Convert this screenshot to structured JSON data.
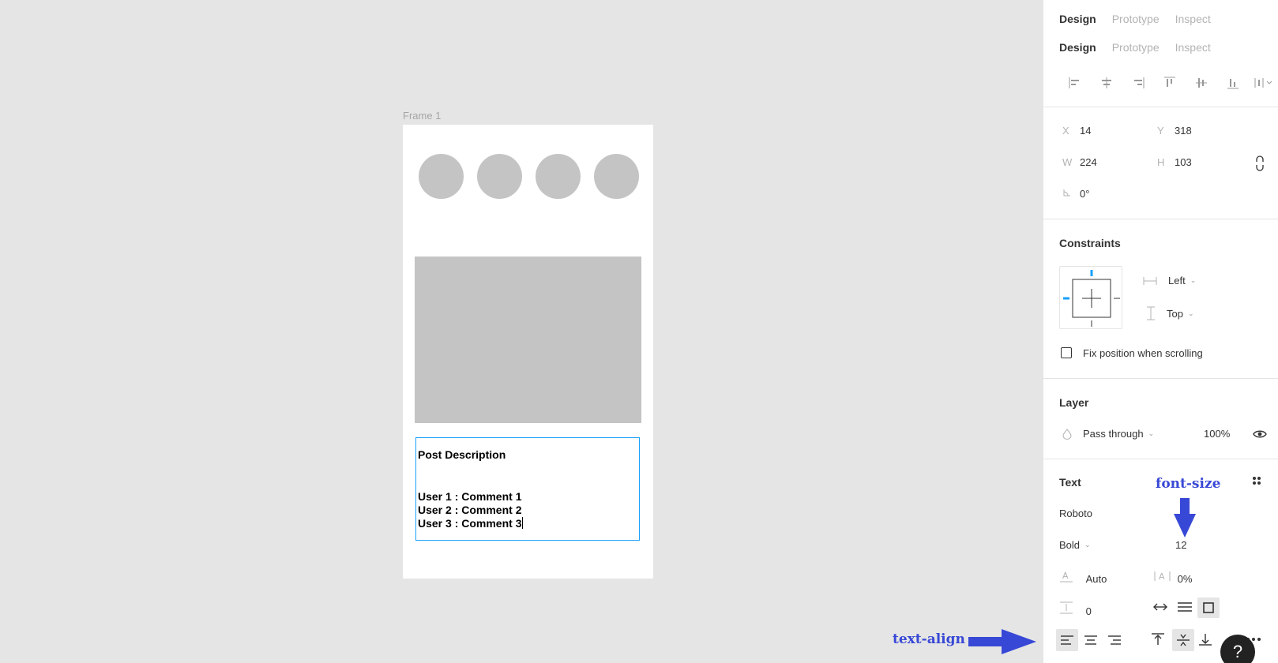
{
  "canvas": {
    "frame_label": "Frame 1",
    "text_box": {
      "lines": [
        "Post Description",
        "User 1 : Comment 1",
        "User 2 : Comment 2",
        "User 3 : Comment 3"
      ]
    }
  },
  "annotations": {
    "font_size_label": "font-size",
    "text_align_label": "text-align",
    "color": "#3848d6"
  },
  "panel": {
    "tabs_row1": [
      "Design",
      "Prototype",
      "Inspect"
    ],
    "tabs_row2": [
      "Design",
      "Prototype",
      "Inspect"
    ],
    "align_icons": [
      "align-left-icon",
      "align-horizontal-center-icon",
      "align-right-icon",
      "align-top-icon",
      "align-vertical-center-icon",
      "align-bottom-icon",
      "distribute-icon"
    ],
    "position": {
      "x_label": "X",
      "x_value": "14",
      "y_label": "Y",
      "y_value": "318",
      "w_label": "W",
      "w_value": "224",
      "h_label": "H",
      "h_value": "103",
      "rotation_value": "0°"
    },
    "constraints": {
      "title": "Constraints",
      "horizontal": "Left",
      "vertical": "Top",
      "fix_position_label": "Fix position when scrolling"
    },
    "layer": {
      "title": "Layer",
      "blend_mode": "Pass through",
      "opacity": "100%"
    },
    "text": {
      "title": "Text",
      "font_family": "Roboto",
      "font_weight": "Bold",
      "font_size": "12",
      "line_height": "Auto",
      "letter_spacing": "0%",
      "paragraph_spacing": "0"
    },
    "help_label": "?"
  },
  "colors": {
    "accent": "#18a0fb",
    "placeholder_gray": "#c4c4c4",
    "canvas_bg": "#e5e5e5"
  }
}
